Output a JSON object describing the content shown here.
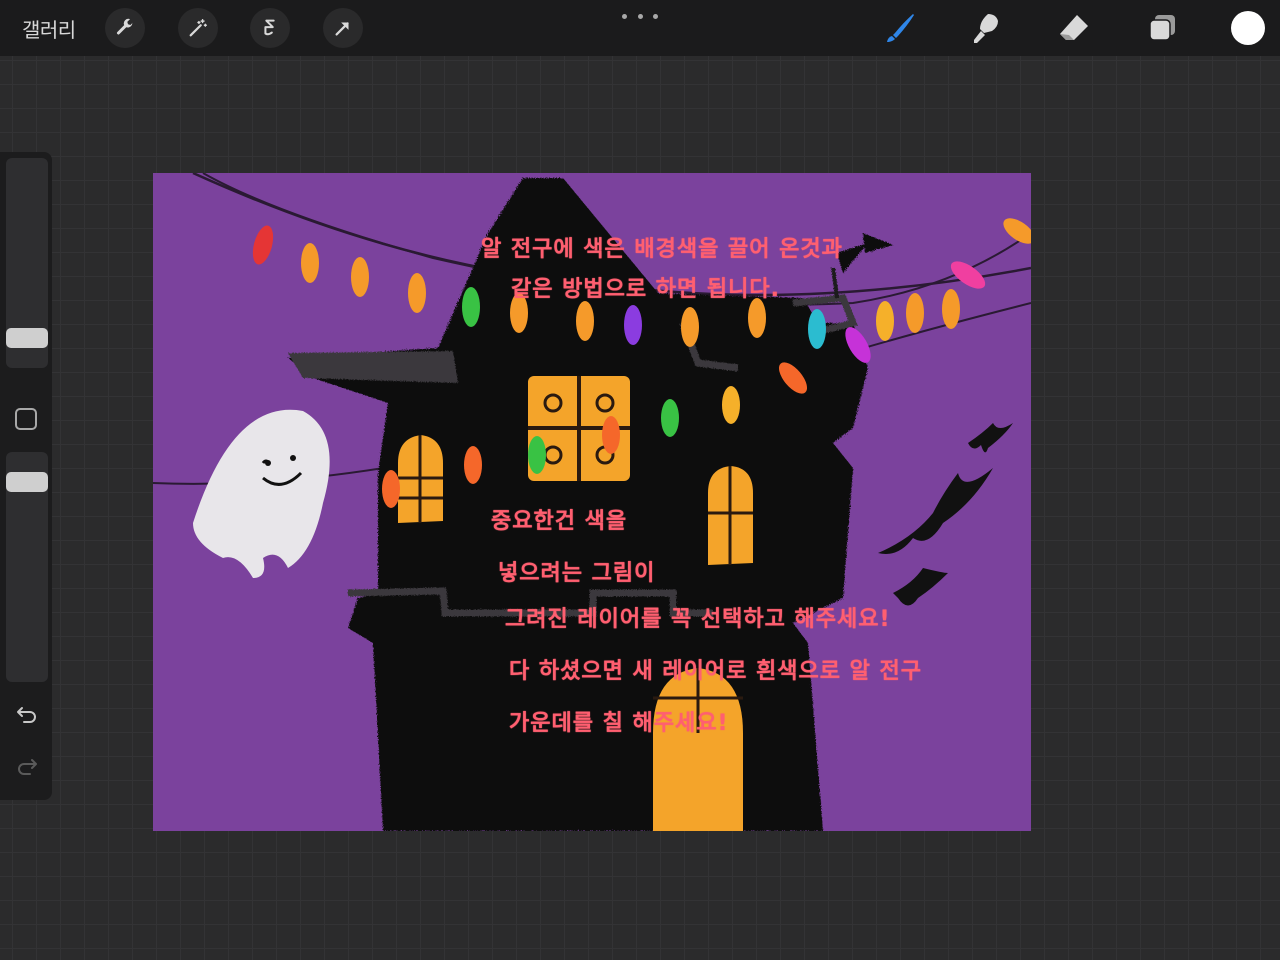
{
  "topbar": {
    "gallery_label": "갤러리",
    "tools_left": [
      "wrench-icon",
      "magic-wand-icon",
      "selection-icon",
      "transform-arrow-icon"
    ],
    "more_icon": "ellipsis-icon",
    "tools_right": [
      "brush-icon",
      "smudge-icon",
      "eraser-icon",
      "layers-icon"
    ],
    "current_color": "#ffffff",
    "active_tool_color": "#2f86e8"
  },
  "sidebar": {
    "brush_size_level": 0.25,
    "opacity_level": 0.85,
    "icons": [
      "modify-square-icon",
      "undo-icon",
      "redo-icon"
    ]
  },
  "canvas": {
    "background_color": "#7b429d",
    "notes": {
      "line1": "알 전구에 색은 배경색을 끌어 온것과",
      "line2": "같은 방법으로 하면 됩니다.",
      "line3": "중요한건 색을",
      "line4": "넣으려는 그림이",
      "line5": "그려진 레이어를 꼭 선택하고 해주세요!",
      "line6": "다 하셨으면 새 레이어로 흰색으로 알 전구",
      "line7": "가운데를 칠 해주세요!"
    },
    "note_color": "#ff5f70"
  }
}
